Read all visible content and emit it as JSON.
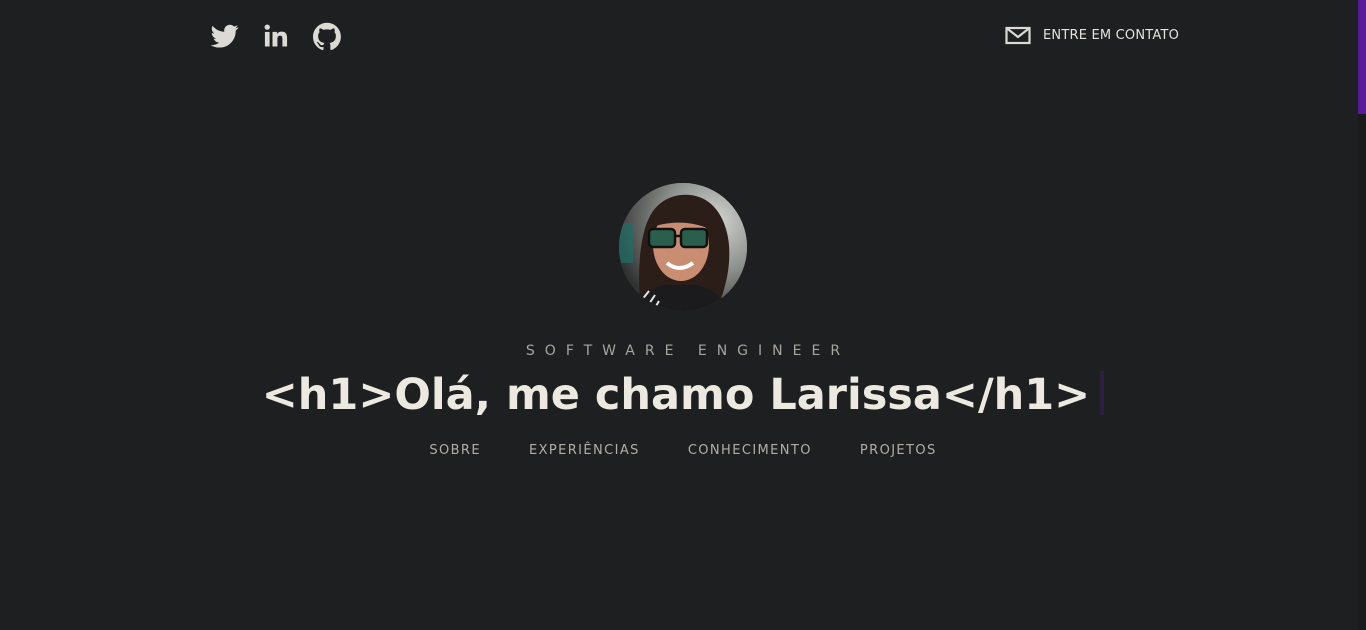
{
  "header": {
    "social": [
      {
        "name": "twitter-icon",
        "label": "Twitter"
      },
      {
        "name": "linkedin-icon",
        "label": "LinkedIn"
      },
      {
        "name": "github-icon",
        "label": "GitHub"
      }
    ],
    "contact_label": "ENTRE EM CONTATO"
  },
  "hero": {
    "role": "SOFTWARE ENGINEER",
    "headline": "<h1>Olá, me chamo Larissa</h1>"
  },
  "nav": {
    "items": [
      {
        "label": "SOBRE"
      },
      {
        "label": "EXPERIÊNCIAS"
      },
      {
        "label": "CONHECIMENTO"
      },
      {
        "label": "PROJETOS"
      }
    ]
  },
  "colors": {
    "background": "#1e1f21",
    "accent": "#5a189a",
    "text": "#ece9e1",
    "muted": "#b2aea6"
  }
}
